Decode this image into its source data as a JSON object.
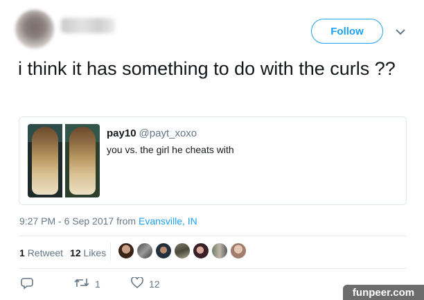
{
  "header": {
    "follow_label": "Follow"
  },
  "tweet": {
    "text": "i think it has something to do with the curls ??"
  },
  "quote": {
    "name": "pay10",
    "handle": "@payt_xoxo",
    "text": "you vs. the girl he cheats with"
  },
  "meta": {
    "time_date": "9:27 PM - 6 Sep 2017 from ",
    "location": "Evansville, IN"
  },
  "stats": {
    "retweets_count": "1",
    "retweets_label": "Retweet",
    "likes_count": "12",
    "likes_label": "Likes"
  },
  "actions": {
    "retweet_count": "1",
    "like_count": "12"
  },
  "watermark": "funpeer.com",
  "colors": {
    "accent": "#1da1f2",
    "muted": "#657786",
    "text": "#14171a"
  }
}
